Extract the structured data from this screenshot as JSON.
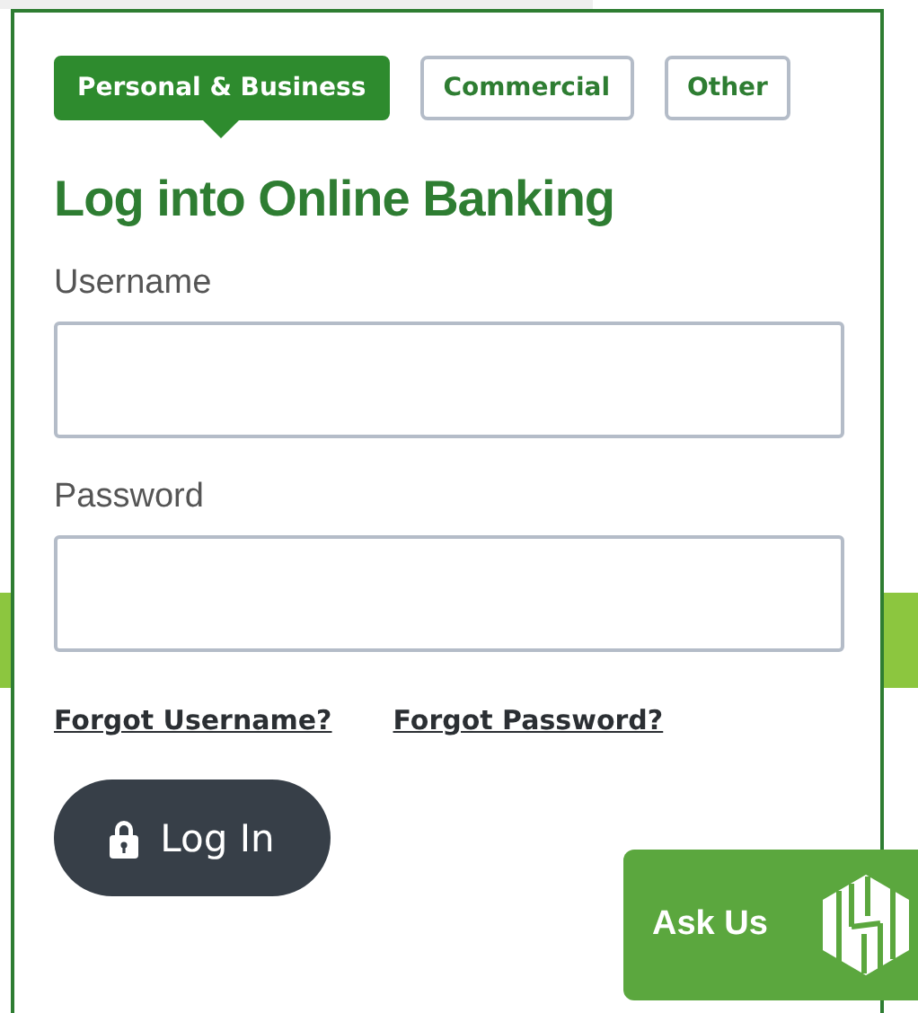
{
  "tabs": [
    {
      "label": "Personal & Business",
      "selected": true
    },
    {
      "label": "Commercial",
      "selected": false
    },
    {
      "label": "Other",
      "selected": false
    }
  ],
  "heading": "Log into Online Banking",
  "fields": [
    {
      "label": "Username"
    },
    {
      "label": "Password"
    }
  ],
  "links": [
    "Forgot Username?",
    "Forgot Password?"
  ],
  "login_button": {
    "label": "Log In"
  },
  "chat_button": {
    "label": "Ask Us"
  }
}
